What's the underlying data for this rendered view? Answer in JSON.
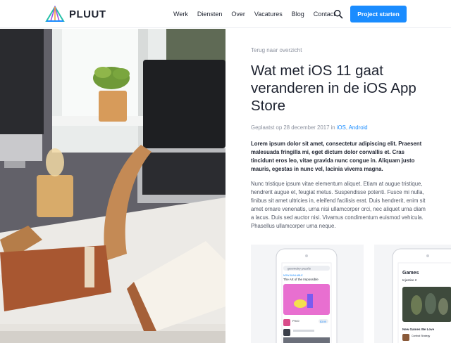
{
  "header": {
    "logo_text": "PLUUT",
    "nav": [
      "Werk",
      "Diensten",
      "Over",
      "Vacatures",
      "Blog",
      "Contact"
    ],
    "cta_label": "Project starten",
    "icons": {
      "search": "search-icon",
      "logo": "logo-mark-icon"
    },
    "accent_color": "#1a8cff"
  },
  "article": {
    "back_link": "Terug naar overzicht",
    "title": "Wat met iOS 11 gaat veranderen in de iOS App Store",
    "meta_prefix": "Geplaatst op 28 december 2017 in",
    "tags": [
      "iOS",
      "Android"
    ],
    "lead": "Lorem ipsum dolor sit amet, consectetur adipiscing elit. Praesent malesuada fringilla mi, eget dictum dolor convallis et. Cras tincidunt eros leo, vitae gravida nunc congue in. Aliquam justo mauris, egestas in nunc vel, lacinia viverra magna.",
    "body": "Nunc tristique ipsum vitae elementum aliquet. Etiam at augue tristique, hendrerit augue et, feugiat metus. Suspendisse potenti. Fusce mi nulla, finibus sit amet ultricies in, eleifend facilisis erat. Duis hendrerit, enim sit amet ornare venenatis, urna nisi ullamcorper orci, nec aliquet urna diam a lacus. Duis sed auctor nisi. Vivamus condimentum euismod vehicula. Phasellus ullamcorper urna neque."
  },
  "screenshots": [
    {
      "search": "geometry puzzle",
      "label": "NOW AVAILABLE",
      "heading": "The Art of the Impossible",
      "app_name": "PIVO",
      "price": "$3.99"
    },
    {
      "heading": "Games",
      "featured": "Injustice 2",
      "section": "New Games We Love",
      "app_name": "Combat Strategy"
    }
  ]
}
